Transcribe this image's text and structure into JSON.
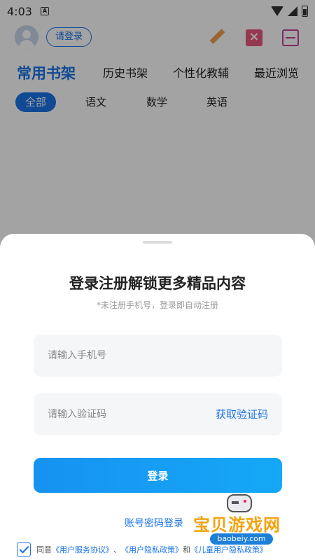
{
  "status_bar": {
    "time": "4:03",
    "notification": "A"
  },
  "header": {
    "login_button": "请登录"
  },
  "main_tabs": [
    "常用书架",
    "历史书架",
    "个性化教辅",
    "最近浏览"
  ],
  "sub_tabs": [
    "全部",
    "语文",
    "数学",
    "英语"
  ],
  "sheet": {
    "title": "登录注册解锁更多精品内容",
    "subtitle": "*未注册手机号，登录即自动注册",
    "phone_placeholder": "请输入手机号",
    "code_placeholder": "请输入验证码",
    "get_code": "获取验证码",
    "login_button": "登录",
    "password_login": "账号密码登录",
    "agree_prefix": "同意",
    "service_agreement": "《用户服务协议》",
    "separator": "、",
    "privacy_policy": "《用户隐私政策》",
    "conjunction": "和",
    "children_policy": "《儿童用户隐私政策》"
  },
  "watermark": {
    "name": "宝贝游戏网",
    "domain": "baobeiy.com"
  },
  "colors": {
    "accent": "#1a73e8",
    "button_start": "#1692f0",
    "button_end": "#15a8f7",
    "sheet_bg": "#ffffff",
    "field_bg": "#f5f6f8"
  }
}
